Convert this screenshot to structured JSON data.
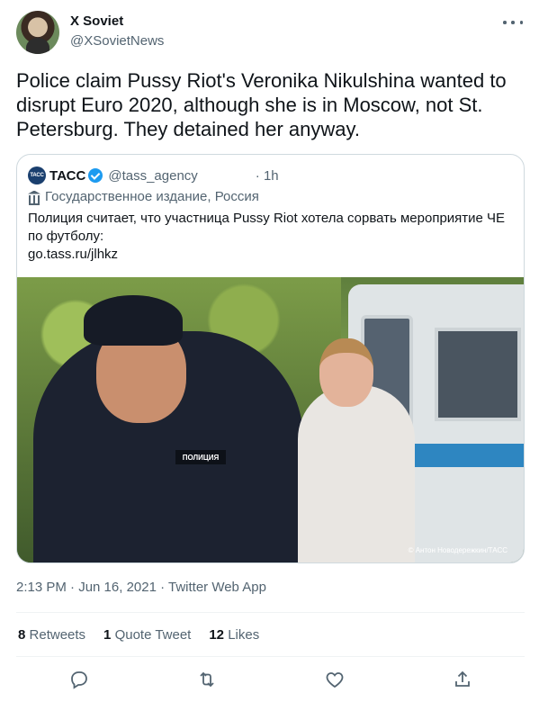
{
  "author": {
    "display_name": "X Soviet",
    "handle": "@XSovietNews"
  },
  "tweet": {
    "text": "Police claim Pussy Riot's Veronika Nikulshina wanted to disrupt Euro 2020, although she is in Moscow, not St. Petersburg. They detained her anyway.",
    "timestamp": "2:13 PM · Jun 16, 2021 · Twitter Web App"
  },
  "quote": {
    "logo_text": "ТАСС",
    "name": "ТАСС",
    "handle": "@tass_agency",
    "time": "· 1h",
    "label": "Государственное издание, Россия",
    "text": "Полиция считает, что участница Pussy Riot хотела сорвать мероприятие ЧЕ по футболу:",
    "link": "go.tass.ru/jlhkz",
    "photo": {
      "patch_text": "ПОЛИЦИЯ",
      "credit": "© Антон Новодережкин/ТАСС"
    }
  },
  "stats": {
    "retweets_count": "8",
    "retweets_label": "Retweets",
    "quotes_count": "1",
    "quotes_label": "Quote Tweet",
    "likes_count": "12",
    "likes_label": "Likes"
  },
  "icons": [
    "more-icon",
    "verified-icon",
    "gov-icon",
    "reply-icon",
    "retweet-icon",
    "like-icon",
    "share-icon"
  ],
  "colors": {
    "verified": "#1d9bf0",
    "secondary_text": "#536471"
  }
}
